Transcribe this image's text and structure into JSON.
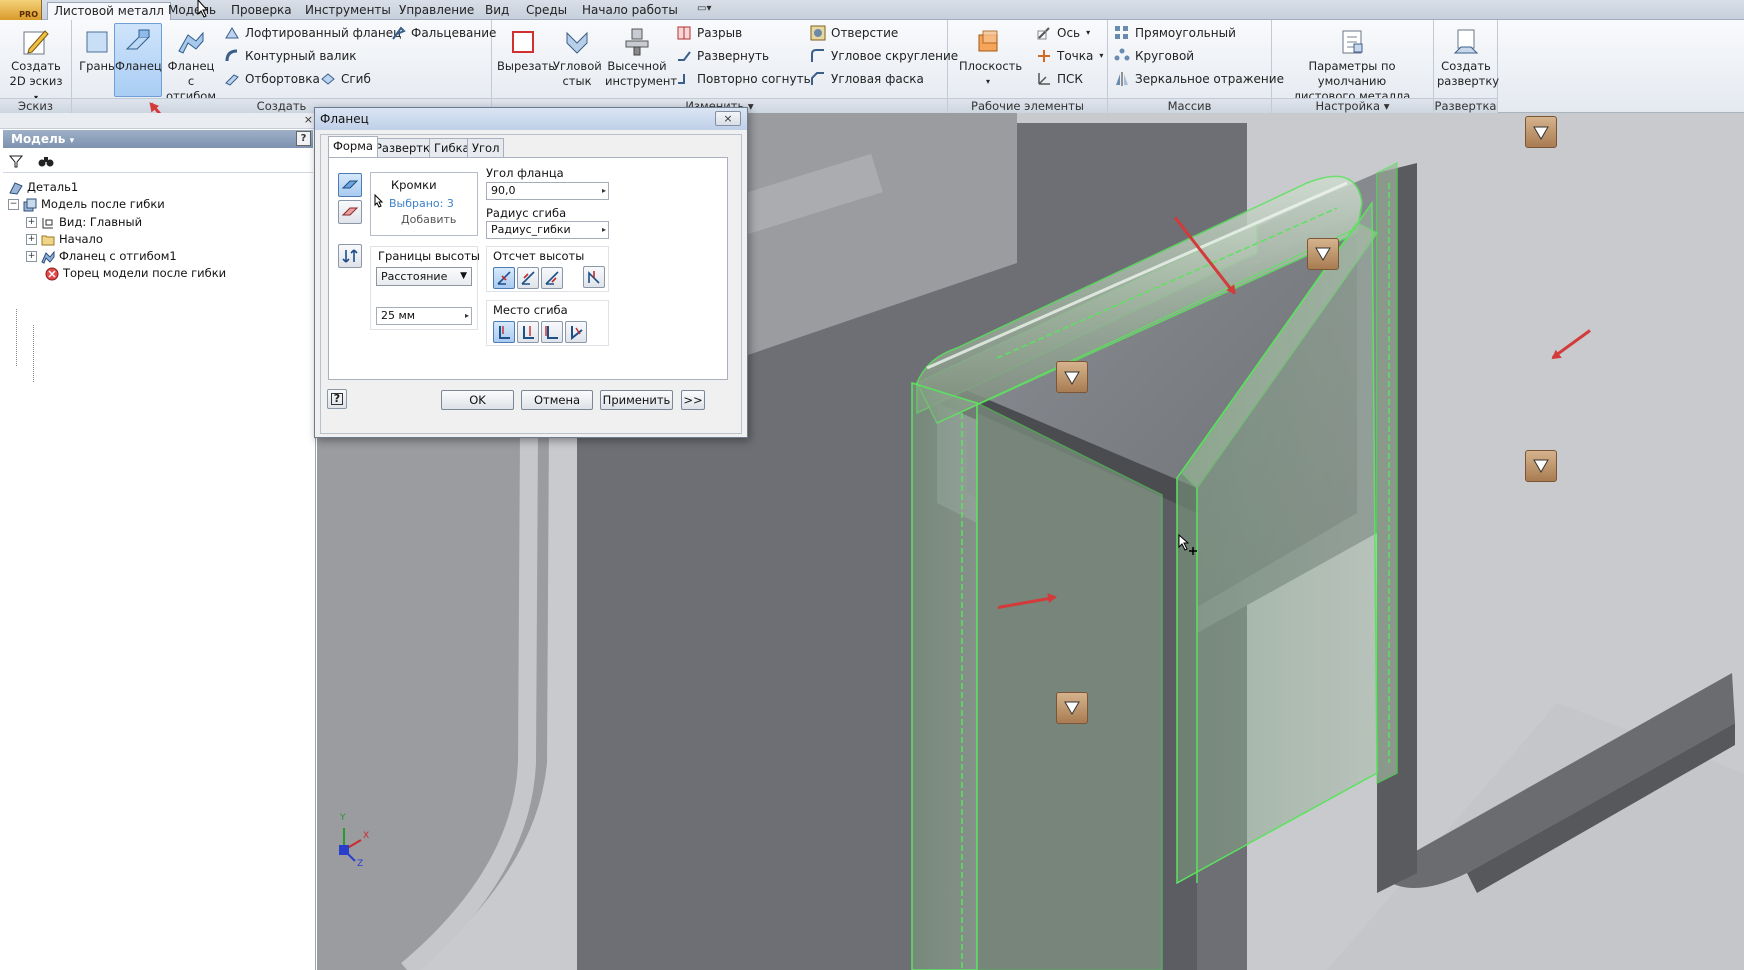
{
  "menu": {
    "app_badge": "PRO",
    "tabs": [
      "Листовой металл",
      "Модель",
      "Проверка",
      "Инструменты",
      "Управление",
      "Вид",
      "Среды",
      "Начало работы"
    ]
  },
  "ribbon": {
    "groups": {
      "sketch": "Эскиз",
      "create": "Создать",
      "modify": "Изменить",
      "work": "Рабочие элементы",
      "pattern": "Массив",
      "setup": "Настройка",
      "flat": "Развертка"
    },
    "create_sketch": [
      "Создать",
      "2D эскиз"
    ],
    "face": "Грань",
    "flange": "Фланец",
    "contour_flange": [
      "Фланец с",
      "отгибом"
    ],
    "lofted_flange": "Лофтированный фланец",
    "hem": "Фальцевание",
    "contour_roll": "Контурный валик",
    "flange_rolls": "Отбортовка",
    "bend": "Сгиб",
    "cut": "Вырезать",
    "corner_seam": [
      "Угловой",
      "стык"
    ],
    "punch_tool": [
      "Высечной",
      "инструмент"
    ],
    "rip": "Разрыв",
    "unfold": "Развернуть",
    "refold": "Повторно согнуть",
    "hole": "Отверстие",
    "corner_round": "Угловое скругление",
    "corner_chamfer": "Угловая фаска",
    "plane": "Плоскость",
    "axis": "Ось",
    "point": "Точка",
    "ucs": "ПСК",
    "rectangular": "Прямоугольный",
    "circular": "Круговой",
    "mirror": "Зеркальное отражение",
    "sheet_defaults": [
      "Параметры по умолчанию",
      "листового металла"
    ],
    "create_flat": [
      "Создать",
      "развертку"
    ]
  },
  "browser": {
    "title": "Модель",
    "help": "?",
    "close": "×",
    "tree": [
      {
        "label": "Деталь1"
      },
      {
        "label": "Модель после гибки"
      },
      {
        "label": "Вид: Главный"
      },
      {
        "label": "Начало"
      },
      {
        "label": "Фланец с отгибом1"
      },
      {
        "label": "Торец модели после гибки"
      }
    ]
  },
  "dialog": {
    "title": "Фланец",
    "close": "×",
    "tabs": [
      "Форма",
      "Развертка",
      "Гибка",
      "Угол"
    ],
    "edges_header": "Кромки",
    "edges_selected": "Выбрано: 3",
    "edges_add": "Добавить",
    "flange_angle_label": "Угол фланца",
    "flange_angle_value": "90,0",
    "bend_radius_label": "Радиус сгиба",
    "bend_radius_value": "Радиус_гибки",
    "height_extents_label": "Границы высоты",
    "height_extents_value": "Расстояние",
    "height_value": "25 мм",
    "height_datum_label": "Отсчет высоты",
    "bend_position_label": "Место сгиба",
    "ok": "OK",
    "cancel": "Отмена",
    "apply": "Применить",
    "more": ">>",
    "help": "?"
  },
  "viewcube": {
    "x": "X",
    "y": "Y",
    "z": "Z"
  },
  "colors": {
    "accent_select": "#a9cdf4",
    "highlight_green": "#58e05a",
    "arrow_red": "#d33a3a",
    "grip_bronze": "#b58a5e"
  }
}
